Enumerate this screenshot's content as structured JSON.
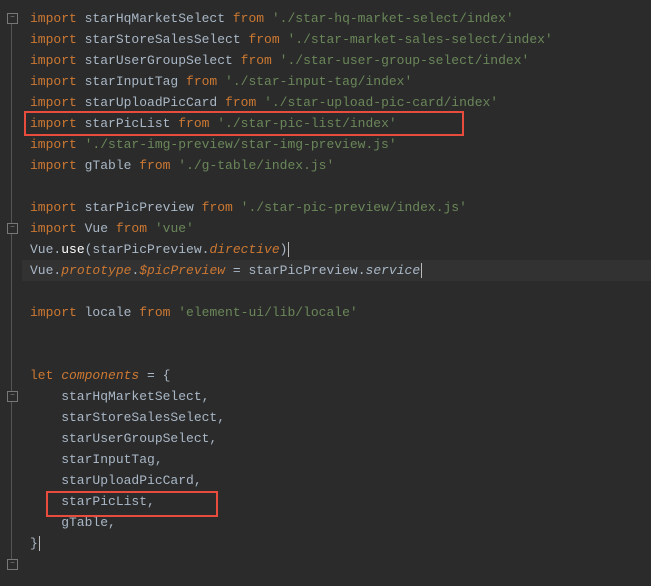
{
  "lines": {
    "l1_kw1": "import",
    "l1_id": " starHqMarketSelect ",
    "l1_kw2": "from",
    "l1_str": " './star-hq-market-select/index'",
    "l2_kw1": "import",
    "l2_id": " starStoreSalesSelect ",
    "l2_kw2": "from",
    "l2_str": " './star-market-sales-select/index'",
    "l3_kw1": "import",
    "l3_id": " starUserGroupSelect ",
    "l3_kw2": "from",
    "l3_str": " './star-user-group-select/index'",
    "l4_kw1": "import",
    "l4_id": " starInputTag ",
    "l4_kw2": "from",
    "l4_str": " './star-input-tag/index'",
    "l5_kw1": "import",
    "l5_id": " starUploadPicCard ",
    "l5_kw2": "from",
    "l5_str": " './star-upload-pic-card/index'",
    "l6_kw1": "import",
    "l6_id": " starPicList ",
    "l6_kw2": "from",
    "l6_str": " './star-pic-list/index'",
    "l7_kw1": "import",
    "l7_str": " './star-img-preview/star-img-preview.js'",
    "l8_kw1": "import",
    "l8_id": " gTable ",
    "l8_kw2": "from",
    "l8_str": " './g-table/index.js'",
    "l10_kw1": "import",
    "l10_id": " starPicPreview ",
    "l10_kw2": "from",
    "l10_str": " './star-pic-preview/index.js'",
    "l11_kw1": "import",
    "l11_id": " Vue ",
    "l11_kw2": "from",
    "l11_str": " 'vue'",
    "l12_a": "Vue.",
    "l12_b": "use",
    "l12_c": "(starPicPreview.",
    "l12_d": "directive",
    "l12_e": ")",
    "l13_a": "Vue.",
    "l13_b": "prototype",
    "l13_c": ".",
    "l13_d": "$picPreview",
    "l13_e": " = starPicPreview.",
    "l13_f": "service",
    "l15_kw1": "import",
    "l15_id": " locale ",
    "l15_kw2": "from",
    "l15_str": " 'element-ui/lib/locale'",
    "l18_a": "let",
    "l18_b": " ",
    "l18_c": "components",
    "l18_d": " = {",
    "l19": "    starHqMarketSelect,",
    "l20": "    starStoreSalesSelect,",
    "l21": "    starUserGroupSelect,",
    "l22": "    starInputTag,",
    "l23": "    starUploadPicCard,",
    "l24": "    starPicList,",
    "l25": "    gTable,",
    "l26": "}"
  }
}
